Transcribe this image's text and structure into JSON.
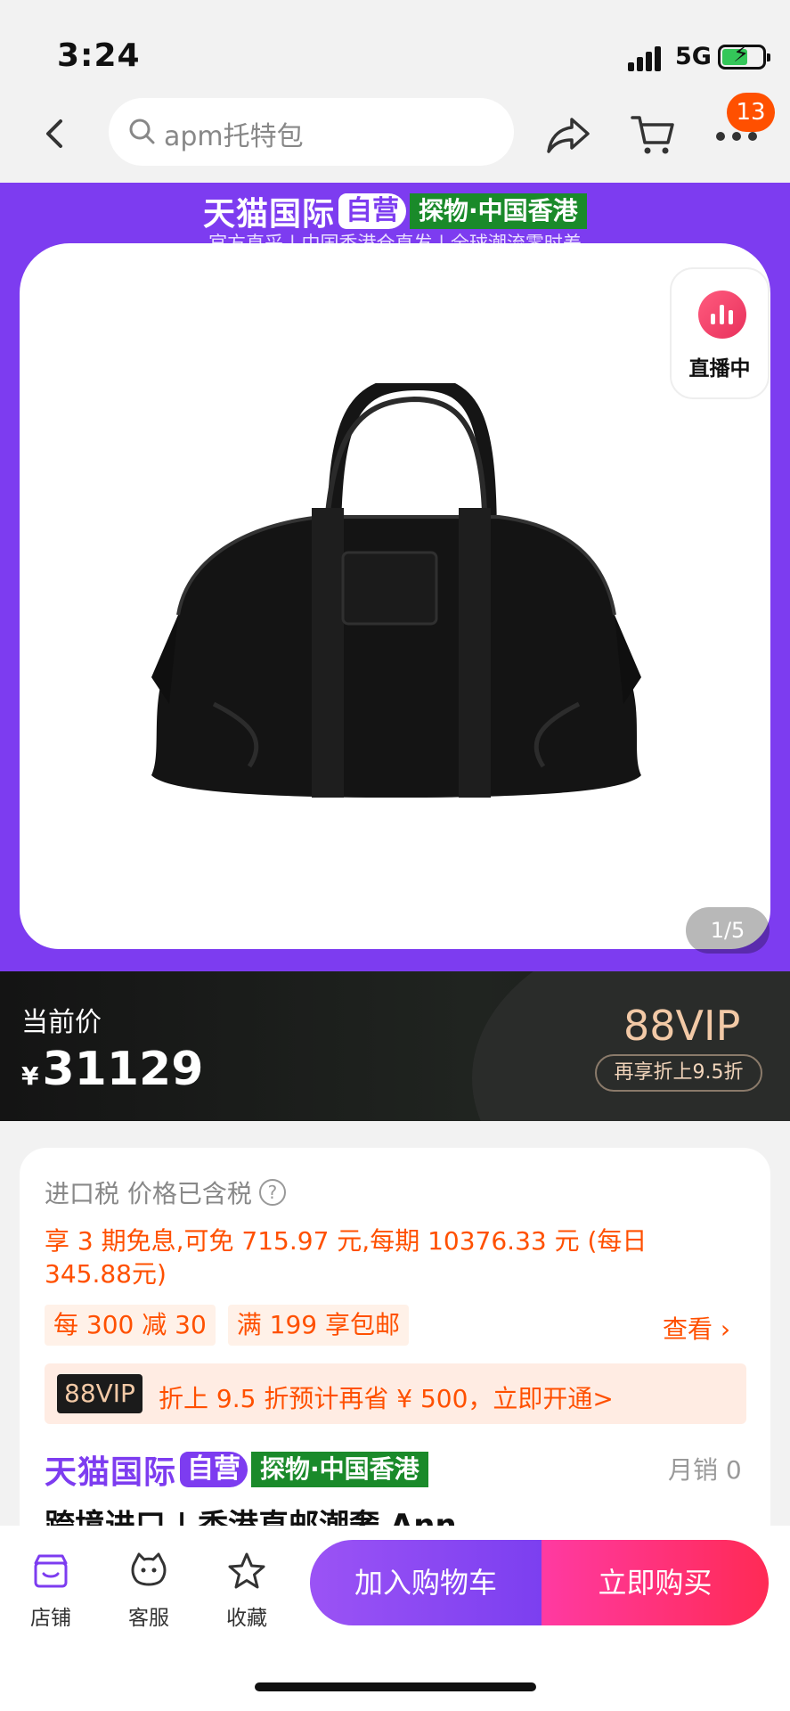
{
  "status_bar": {
    "time": "3:24",
    "network": "5G"
  },
  "nav": {
    "search_text": "apm托特包",
    "cart_badge": "13"
  },
  "banner": {
    "logo_tmall": "天猫国际",
    "logo_self": "自营",
    "logo_tag": "探物·中国香港",
    "subtitle": "官方直采 | 中国香港仓直发 | 全球潮流零时差",
    "live_label": "直播中",
    "pager": "1/5"
  },
  "price": {
    "label": "当前价",
    "currency": "¥",
    "value": "31129",
    "vip_title": "88VIP",
    "vip_note": "再享折上9.5折"
  },
  "info": {
    "tax_note": "进口税 价格已含税",
    "installment": "享 3 期免息,可免 715.97 元,每期 10376.33 元 (每日 345.88元)",
    "coupons": [
      "每 300 减 30",
      "满 199 享包邮"
    ],
    "see_more": "查看 ›",
    "vip_tag": "88VIP",
    "vip_message": "折上 9.5 折预计再省 ¥ 500，立即开通>",
    "brand_tmall": "天猫国际",
    "brand_self": "自营",
    "brand_tag": "探物·中国香港",
    "monthly_sales": "月销 0",
    "title_partial": "跨境进口 | 香港直邮潮奢 Ann"
  },
  "bottom": {
    "tabs": [
      {
        "label": "店铺",
        "icon": "store-icon"
      },
      {
        "label": "客服",
        "icon": "customer-service-icon"
      },
      {
        "label": "收藏",
        "icon": "star-icon"
      }
    ],
    "add_to_cart": "加入购物车",
    "buy_now": "立即购买"
  },
  "colors": {
    "brand_purple": "#7d3cf0",
    "accent_orange": "#ff5000",
    "buy_pink": "#ff2a55"
  }
}
